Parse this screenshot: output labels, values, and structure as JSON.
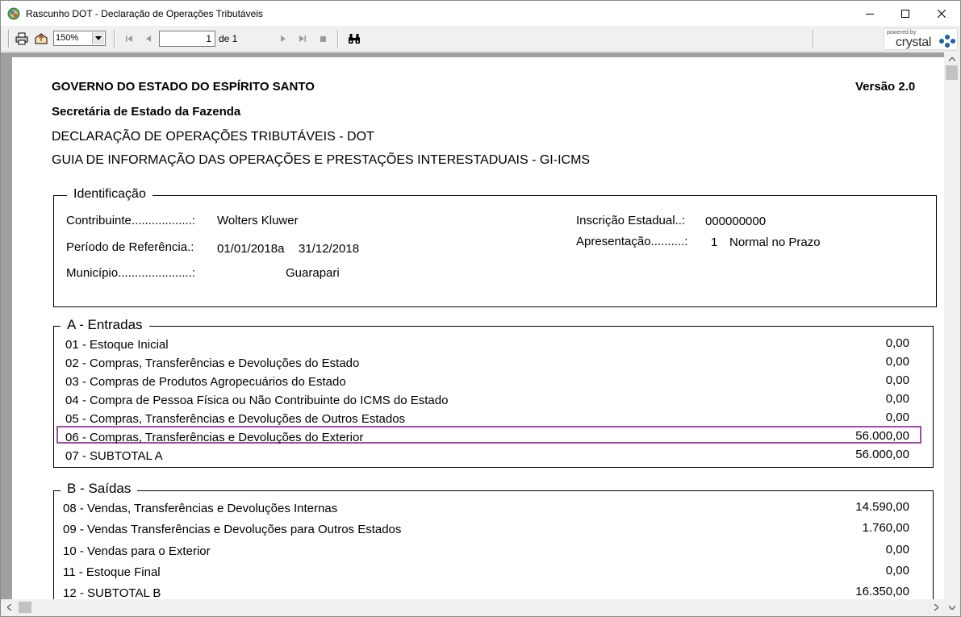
{
  "window": {
    "title": "Rascunho DOT - Declaração de Operações Tributáveis"
  },
  "toolbar": {
    "zoom": "150%",
    "page_current": "1",
    "page_of": "de 1",
    "brand_powered": "powered by",
    "brand_name": "crystal"
  },
  "report": {
    "header": {
      "line1": "GOVERNO DO ESTADO DO ESPÍRITO SANTO",
      "version": "Versão 2.0",
      "line2": "Secretária de Estado da Fazenda",
      "line3": "DECLARAÇÃO DE OPERAÇÕES TRIBUTÁVEIS - DOT",
      "line4": "GUIA DE INFORMAÇÃO DAS OPERAÇÕES E PRESTAÇÕES INTERESTADUAIS  - GI-ICMS"
    },
    "identificacao": {
      "legend": "Identificação",
      "contribuinte_label": "Contribuinte..................:",
      "contribuinte_value": "Wolters Kluwer",
      "periodo_label": "Período de Referência.:",
      "periodo_inicio": "01/01/2018a",
      "periodo_fim": "31/12/2018",
      "municipio_label": "Município......................:",
      "municipio_value": "Guarapari",
      "inscricao_label": "Inscrição Estadual..:",
      "inscricao_value": "000000000",
      "apresentacao_label": "Apresentação..........:",
      "apresentacao_code": "1",
      "apresentacao_value": "Normal no Prazo"
    },
    "entradas": {
      "legend": "A - Entradas",
      "rows": [
        {
          "label": "01 - Estoque Inicial",
          "value": "0,00"
        },
        {
          "label": "02 - Compras, Transferências e Devoluções do Estado",
          "value": "0,00"
        },
        {
          "label": "03 - Compras de Produtos Agropecuários do Estado",
          "value": "0,00"
        },
        {
          "label": "04 - Compra de Pessoa Física ou Não Contribuinte do ICMS do Estado",
          "value": "0,00"
        },
        {
          "label": "05 - Compras, Transferências e Devoluções de Outros Estados",
          "value": "0,00"
        },
        {
          "label": "06 - Compras, Transferências e Devoluções do Exterior",
          "value": "56.000,00"
        },
        {
          "label": "07 - SUBTOTAL A",
          "value": "56.000,00"
        }
      ]
    },
    "saidas": {
      "legend": "B - Saídas",
      "rows": [
        {
          "label": "08 - Vendas, Transferências e Devoluções Internas",
          "value": "14.590,00"
        },
        {
          "label": "09 - Vendas Transferências e Devoluções para Outros Estados",
          "value": "1.760,00"
        },
        {
          "label": "10 - Vendas para o Exterior",
          "value": "0,00"
        },
        {
          "label": "11 - Estoque Final",
          "value": "0,00"
        },
        {
          "label": "12 - SUBTOTAL B",
          "value": "16.350,00"
        }
      ]
    }
  },
  "colors": {
    "highlight": "#9b4ea3",
    "viewer_bg": "#a0a0a0"
  }
}
